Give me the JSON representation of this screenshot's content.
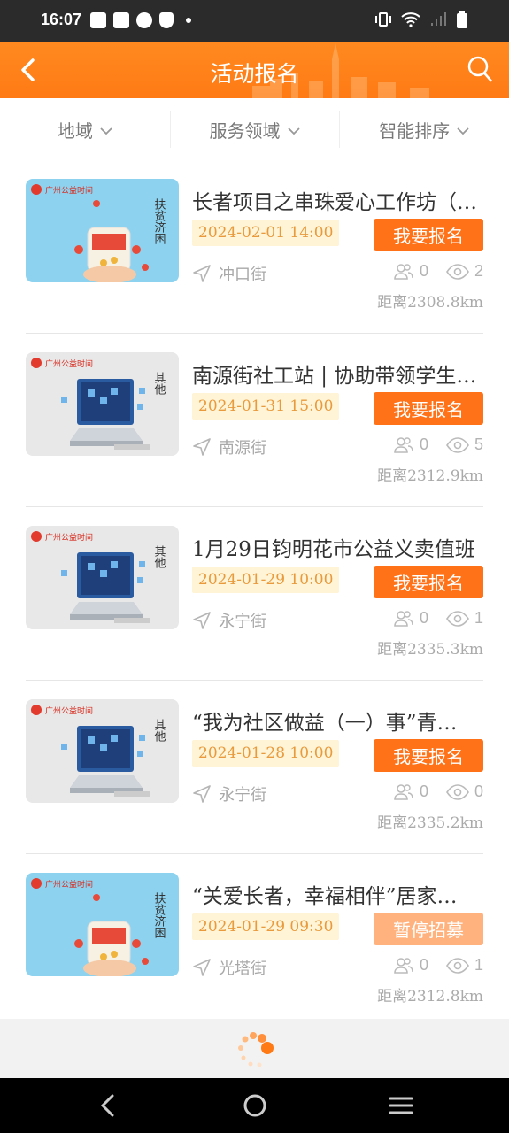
{
  "status_bar": {
    "time": "16:07"
  },
  "header": {
    "title": "活动报名"
  },
  "filters": [
    {
      "label": "地域"
    },
    {
      "label": "服务领域"
    },
    {
      "label": "智能排序"
    }
  ],
  "items": [
    {
      "title": "长者项目之串珠爱心工作坊（…",
      "date": "2024-02-01 14:00",
      "button": "我要报名",
      "location": "冲口街",
      "participants": "0",
      "views": "2",
      "distance": "距离2308.8km",
      "thumb": "charity",
      "thumb_label": "扶贫济困"
    },
    {
      "title": "南源街社工站 | 协助带领学生…",
      "date": "2024-01-31 15:00",
      "button": "我要报名",
      "location": "南源街",
      "participants": "0",
      "views": "5",
      "distance": "距离2312.9km",
      "thumb": "computer",
      "thumb_label": "其他"
    },
    {
      "title": "1月29日钧明花市公益义卖值班",
      "date": "2024-01-29 10:00",
      "button": "我要报名",
      "location": "永宁街",
      "participants": "0",
      "views": "1",
      "distance": "距离2335.3km",
      "thumb": "computer",
      "thumb_label": "其他"
    },
    {
      "title": "“我为社区做益（一）事”青…",
      "date": "2024-01-28 10:00",
      "button": "我要报名",
      "location": "永宁街",
      "participants": "0",
      "views": "0",
      "distance": "距离2335.2km",
      "thumb": "computer",
      "thumb_label": "其他"
    },
    {
      "title": "“关爱长者，幸福相伴”居家…",
      "date": "2024-01-29 09:30",
      "button": "暂停招募",
      "location": "光塔街",
      "participants": "0",
      "views": "1",
      "distance": "距离2312.8km",
      "thumb": "charity",
      "thumb_label": "扶贫济困",
      "disabled": true
    }
  ],
  "colors": {
    "accent": "#ff7218",
    "header": "#ff8a1f",
    "date_bg": "#fff4d6",
    "date_text": "#e89a3c"
  }
}
